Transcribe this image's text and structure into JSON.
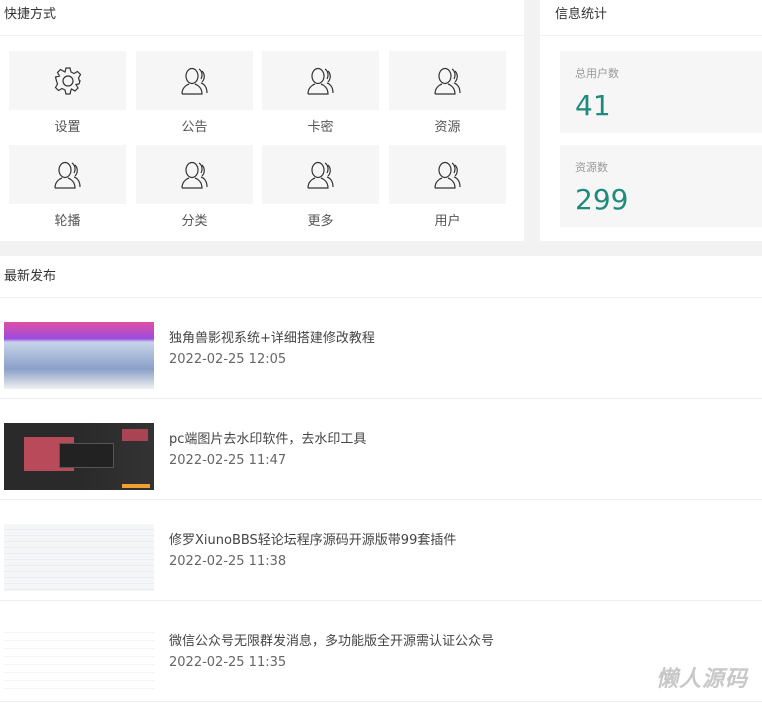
{
  "quick": {
    "title": "快捷方式",
    "tiles": [
      {
        "label": "设置",
        "icon": "gear-icon"
      },
      {
        "label": "公告",
        "icon": "users-icon"
      },
      {
        "label": "卡密",
        "icon": "users-icon"
      },
      {
        "label": "资源",
        "icon": "users-icon"
      },
      {
        "label": "轮播",
        "icon": "users-icon"
      },
      {
        "label": "分类",
        "icon": "users-icon"
      },
      {
        "label": "更多",
        "icon": "users-icon"
      },
      {
        "label": "用户",
        "icon": "users-icon"
      }
    ]
  },
  "stats": {
    "title": "信息统计",
    "items": [
      {
        "label": "总用户数",
        "value": "41"
      },
      {
        "label": "资源数",
        "value": "299"
      }
    ],
    "accent": "#1e8b7c"
  },
  "latest": {
    "title": "最新发布",
    "items": [
      {
        "title": "独角兽影视系统+详细搭建修改教程",
        "date": "2022-02-25 12:05"
      },
      {
        "title": "pc端图片去水印软件，去水印工具",
        "date": "2022-02-25 11:47"
      },
      {
        "title": "修罗XiunoBBS轻论坛程序源码开源版带99套插件",
        "date": "2022-02-25 11:38"
      },
      {
        "title": "微信公众号无限群发消息，多功能版全开源需认证公众号",
        "date": "2022-02-25 11:35"
      }
    ]
  },
  "watermark": "懒人源码"
}
